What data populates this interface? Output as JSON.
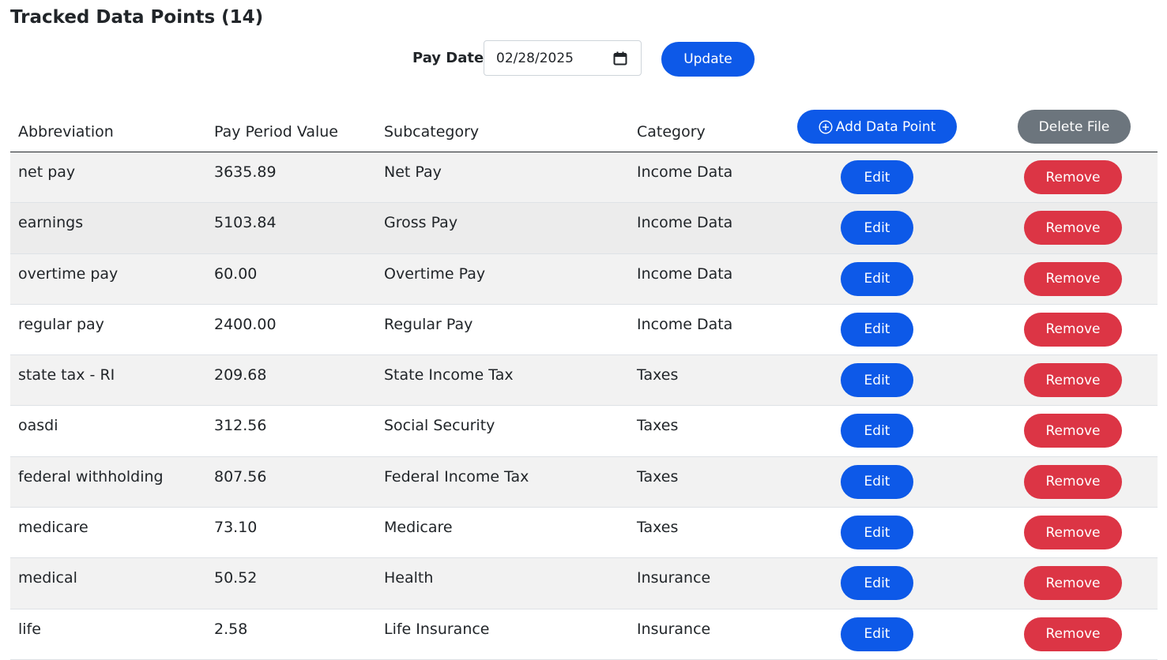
{
  "header": {
    "title": "Tracked Data Points (14)"
  },
  "pay_date": {
    "label": "Pay Date",
    "value": "02/28/2025",
    "update_label": "Update"
  },
  "table": {
    "columns": [
      "Abbreviation",
      "Pay Period Value",
      "Subcategory",
      "Category"
    ],
    "add_label": "Add Data Point",
    "delete_file_label": "Delete File",
    "edit_label": "Edit",
    "remove_label": "Remove",
    "rows": [
      {
        "abbreviation": "net pay",
        "value": "3635.89",
        "subcategory": "Net Pay",
        "category": "Income Data"
      },
      {
        "abbreviation": "earnings",
        "value": "5103.84",
        "subcategory": "Gross Pay",
        "category": "Income Data"
      },
      {
        "abbreviation": "overtime pay",
        "value": "60.00",
        "subcategory": "Overtime Pay",
        "category": "Income Data"
      },
      {
        "abbreviation": "regular pay",
        "value": "2400.00",
        "subcategory": "Regular Pay",
        "category": "Income Data"
      },
      {
        "abbreviation": "state tax - RI",
        "value": "209.68",
        "subcategory": "State Income Tax",
        "category": "Taxes"
      },
      {
        "abbreviation": "oasdi",
        "value": "312.56",
        "subcategory": "Social Security",
        "category": "Taxes"
      },
      {
        "abbreviation": "federal withholding",
        "value": "807.56",
        "subcategory": "Federal Income Tax",
        "category": "Taxes"
      },
      {
        "abbreviation": "medicare",
        "value": "73.10",
        "subcategory": "Medicare",
        "category": "Taxes"
      },
      {
        "abbreviation": "medical",
        "value": "50.52",
        "subcategory": "Health",
        "category": "Insurance"
      },
      {
        "abbreviation": "life",
        "value": "2.58",
        "subcategory": "Life Insurance",
        "category": "Insurance"
      }
    ]
  },
  "colors": {
    "primary": "#0d59e8",
    "secondary": "#6c757d",
    "danger": "#dc3545",
    "stripe": "#f2f2f2"
  }
}
